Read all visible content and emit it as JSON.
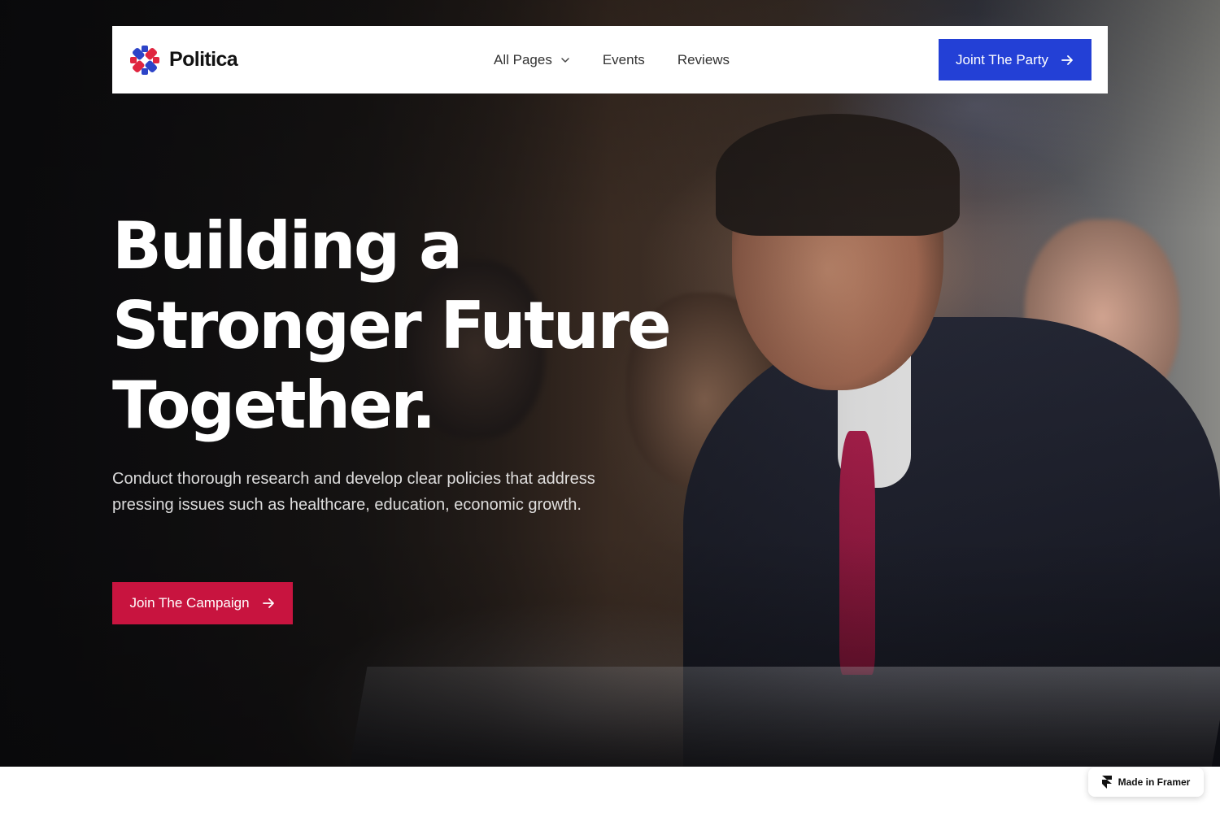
{
  "brand": {
    "name": "Politica",
    "logo_icon": "knot-logo-icon"
  },
  "nav": {
    "items": [
      {
        "label": "All Pages",
        "icon": "chevron-down-icon"
      },
      {
        "label": "Events"
      },
      {
        "label": "Reviews"
      }
    ],
    "cta_label": "Joint The Party"
  },
  "hero": {
    "headline": "Building a Stronger Future Together.",
    "subtext": "Conduct thorough research and develop clear policies that address pressing issues such as healthcare, education, economic growth.",
    "cta_label": "Join The Campaign"
  },
  "badge": {
    "label": "Made in Framer",
    "icon": "framer-icon"
  },
  "colors": {
    "primary_blue": "#2340d6",
    "campaign_red": "#c8143f",
    "logo_red": "#e0253f",
    "logo_blue": "#2d44c8"
  }
}
